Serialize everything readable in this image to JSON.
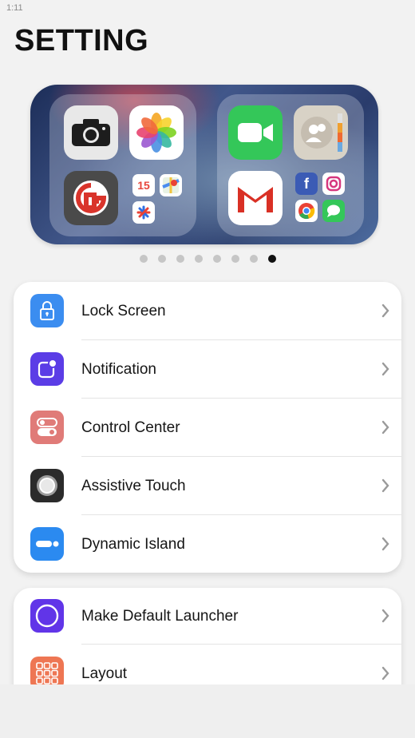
{
  "status": {
    "time": "1:11"
  },
  "header": {
    "title": "SETTING"
  },
  "banner": {
    "apps_left": [
      "camera-icon",
      "photos-icon",
      "app-g-icon",
      "calendar-icon",
      "maps-icon",
      "asterisk-app-icon"
    ],
    "calendar_day": "15",
    "apps_right": [
      "facetime-icon",
      "contacts-icon",
      "gmail-icon",
      "facebook-icon",
      "instagram-icon",
      "chrome-icon",
      "messages-icon"
    ]
  },
  "pager": {
    "count": 8,
    "active_index": 7
  },
  "settings_group_1": [
    {
      "label": "Lock Screen",
      "icon": "lock-icon",
      "color": "#3b8df0"
    },
    {
      "label": "Notification",
      "icon": "notification-icon",
      "color": "#5b3de6"
    },
    {
      "label": "Control Center",
      "icon": "toggle-icon",
      "color": "#e07b78"
    },
    {
      "label": "Assistive Touch",
      "icon": "assistive-touch-icon",
      "color": "#2b2b2b"
    },
    {
      "label": "Dynamic Island",
      "icon": "dynamic-island-icon",
      "color": "#2b8af0"
    }
  ],
  "settings_group_2": [
    {
      "label": "Make Default Launcher",
      "icon": "circle-icon",
      "color": "#6135e8"
    },
    {
      "label": "Layout",
      "icon": "grid-icon",
      "color": "#ee7653"
    }
  ]
}
